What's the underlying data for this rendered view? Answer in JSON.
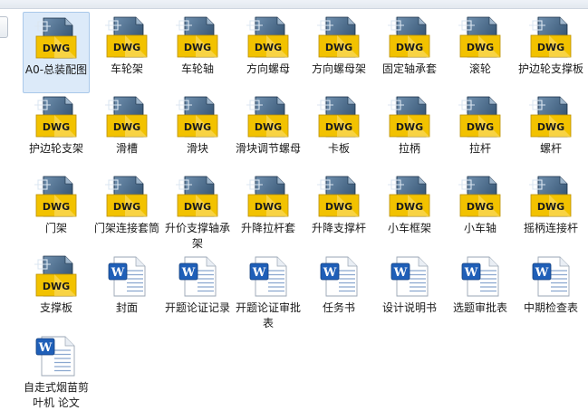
{
  "explorer": {
    "files": [
      {
        "name": "A0-总装配图",
        "type": "dwg",
        "selected": true,
        "icon": "dwg-file-icon"
      },
      {
        "name": "车轮架",
        "type": "dwg",
        "icon": "dwg-file-icon"
      },
      {
        "name": "车轮轴",
        "type": "dwg",
        "icon": "dwg-file-icon"
      },
      {
        "name": "方向螺母",
        "type": "dwg",
        "icon": "dwg-file-icon"
      },
      {
        "name": "方向螺母架",
        "type": "dwg",
        "icon": "dwg-file-icon"
      },
      {
        "name": "固定轴承套",
        "type": "dwg",
        "icon": "dwg-file-icon"
      },
      {
        "name": "滚轮",
        "type": "dwg",
        "icon": "dwg-file-icon"
      },
      {
        "name": "护边轮支撑板",
        "type": "dwg",
        "icon": "dwg-file-icon"
      },
      {
        "name": "护边轮支架",
        "type": "dwg",
        "icon": "dwg-file-icon"
      },
      {
        "name": "滑槽",
        "type": "dwg",
        "icon": "dwg-file-icon"
      },
      {
        "name": "滑块",
        "type": "dwg",
        "icon": "dwg-file-icon"
      },
      {
        "name": "滑块调节螺母",
        "type": "dwg",
        "icon": "dwg-file-icon"
      },
      {
        "name": "卡板",
        "type": "dwg",
        "icon": "dwg-file-icon"
      },
      {
        "name": "拉柄",
        "type": "dwg",
        "icon": "dwg-file-icon"
      },
      {
        "name": "拉杆",
        "type": "dwg",
        "icon": "dwg-file-icon"
      },
      {
        "name": "螺杆",
        "type": "dwg",
        "icon": "dwg-file-icon"
      },
      {
        "name": "门架",
        "type": "dwg",
        "icon": "dwg-file-icon"
      },
      {
        "name": "门架连接套筒",
        "type": "dwg",
        "icon": "dwg-file-icon"
      },
      {
        "name": "升价支撑轴承架",
        "type": "dwg",
        "icon": "dwg-file-icon"
      },
      {
        "name": "升降拉杆套",
        "type": "dwg",
        "icon": "dwg-file-icon"
      },
      {
        "name": "升降支撑杆",
        "type": "dwg",
        "icon": "dwg-file-icon"
      },
      {
        "name": "小车框架",
        "type": "dwg",
        "icon": "dwg-file-icon"
      },
      {
        "name": "小车轴",
        "type": "dwg",
        "icon": "dwg-file-icon"
      },
      {
        "name": "摇柄连接杆",
        "type": "dwg",
        "icon": "dwg-file-icon"
      },
      {
        "name": "支撑板",
        "type": "dwg",
        "icon": "dwg-file-icon"
      },
      {
        "name": "封面",
        "type": "doc",
        "icon": "word-document-icon"
      },
      {
        "name": "开题论证记录",
        "type": "doc",
        "icon": "word-document-icon"
      },
      {
        "name": "开题论证审批表",
        "type": "doc",
        "icon": "word-document-icon"
      },
      {
        "name": "任务书",
        "type": "doc",
        "icon": "word-document-icon"
      },
      {
        "name": "设计说明书",
        "type": "doc",
        "icon": "word-document-icon"
      },
      {
        "name": "选题审批表",
        "type": "doc",
        "icon": "word-document-icon"
      },
      {
        "name": "中期检查表",
        "type": "doc",
        "icon": "word-document-icon"
      },
      {
        "name": "自走式烟苗剪叶机 论文",
        "type": "docx",
        "icon": "word-document-icon"
      }
    ]
  },
  "icons": {
    "dwg_text": "DWG",
    "dwg_gold": "#f2c200",
    "dwg_navy": "#23415f",
    "dwg_steel": "#6f8fae",
    "word_blue": "#1f5fb8",
    "word_letter": "W"
  }
}
